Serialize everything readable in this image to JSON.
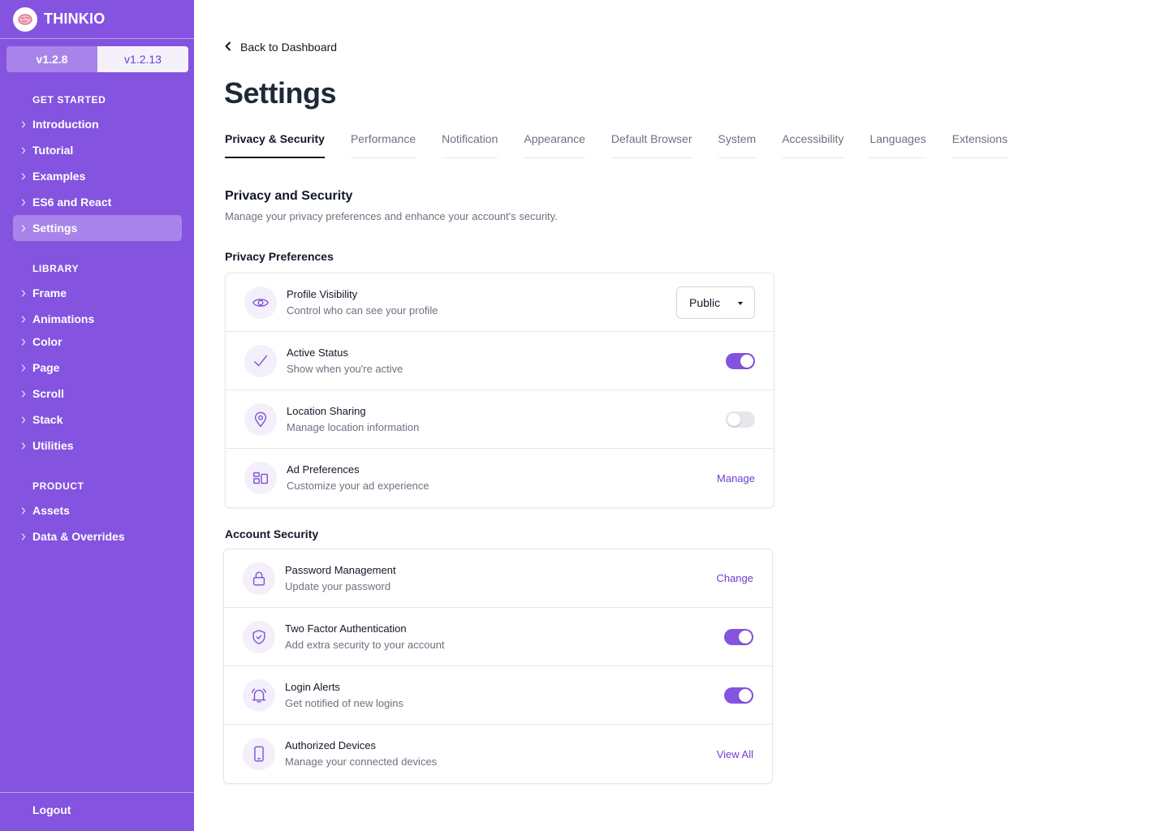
{
  "sidebar": {
    "brand": "THINKIO",
    "versions": [
      "v1.2.8",
      "v1.2.13"
    ],
    "sections": [
      {
        "title": "GET STARTED",
        "items": [
          "Introduction",
          "Tutorial",
          "Examples",
          "ES6 and React",
          "Settings"
        ]
      },
      {
        "title": "LIBRARY",
        "items": [
          "Frame",
          "Animations",
          "Color",
          "Page",
          "Scroll",
          "Stack",
          "Utilities"
        ]
      },
      {
        "title": "PRODUCT",
        "items": [
          "Assets",
          "Data & Overrides"
        ]
      }
    ],
    "selected_item": "Settings",
    "logout": "Logout"
  },
  "header": {
    "back_label": "Back to Dashboard",
    "title": "Settings"
  },
  "tabs": [
    "Privacy & Security",
    "Performance",
    "Notification",
    "Appearance",
    "Default Browser",
    "System",
    "Accessibility",
    "Languages",
    "Extensions"
  ],
  "active_tab": "Privacy & Security",
  "section": {
    "title": "Privacy and Security",
    "description": "Manage your privacy preferences and enhance your account's security."
  },
  "privacy": {
    "title": "Privacy Preferences",
    "rows": [
      {
        "icon": "eye-icon",
        "title": "Profile Visibility",
        "subtitle": "Control who can see your profile",
        "control": "select",
        "value": "Public"
      },
      {
        "icon": "check-icon",
        "title": "Active Status",
        "subtitle": "Show when you're active",
        "control": "toggle",
        "on": true
      },
      {
        "icon": "location-pin-icon",
        "title": "Location Sharing",
        "subtitle": "Manage location information",
        "control": "toggle",
        "on": false
      },
      {
        "icon": "ad-layout-icon",
        "title": "Ad Preferences",
        "subtitle": "Customize your ad experience",
        "control": "link",
        "label": "Manage"
      }
    ]
  },
  "security": {
    "title": "Account Security",
    "rows": [
      {
        "icon": "lock-icon",
        "title": "Password Management",
        "subtitle": "Update your password",
        "control": "link",
        "label": "Change"
      },
      {
        "icon": "shield-check-icon",
        "title": "Two Factor Authentication",
        "subtitle": "Add extra security to your account",
        "control": "toggle",
        "on": true
      },
      {
        "icon": "bell-icon",
        "title": "Login Alerts",
        "subtitle": "Get notified of new logins",
        "control": "toggle",
        "on": true
      },
      {
        "icon": "phone-icon",
        "title": "Authorized Devices",
        "subtitle": "Manage your connected devices",
        "control": "link",
        "label": "View All"
      }
    ]
  },
  "colors": {
    "sidebar_bg": "#8453e0",
    "accent": "#6b3fd0",
    "toggle_on": "#8453e0"
  }
}
